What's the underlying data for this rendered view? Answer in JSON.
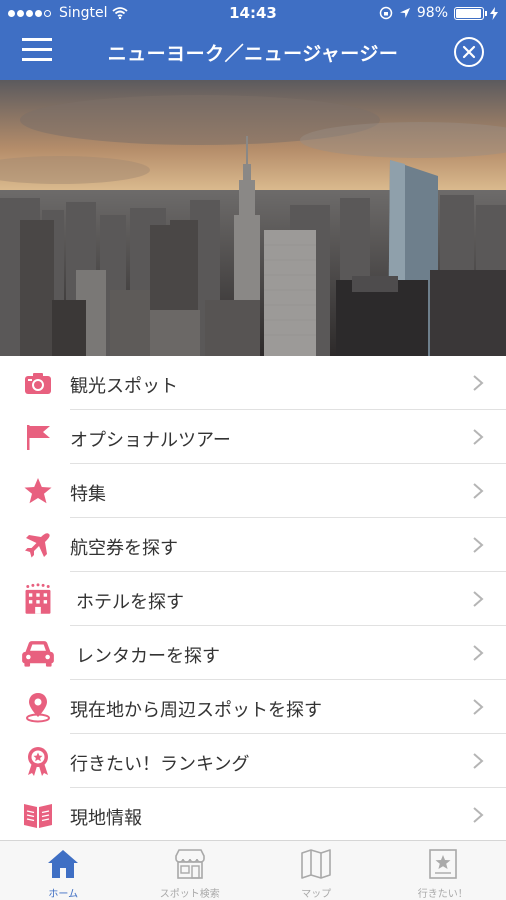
{
  "status_bar": {
    "carrier": "Singtel",
    "time": "14:43",
    "battery": "98%",
    "battery_level": 0.98
  },
  "header": {
    "title": "ニューヨーク／ニュージャージー",
    "menu_icon": "hamburger-icon",
    "close_icon": "close-circle-icon"
  },
  "colors": {
    "header_bg": "#3f6fc4",
    "accent_pink": "#e8607f",
    "tab_active": "#3f6fc4"
  },
  "menu": {
    "items": [
      {
        "label": "観光スポット",
        "icon": "camera-icon"
      },
      {
        "label": "オプショナルツアー",
        "icon": "flag-icon"
      },
      {
        "label": "特集",
        "icon": "star-icon"
      },
      {
        "label": "航空券を探す",
        "icon": "airplane-icon"
      },
      {
        "label": "ホテルを探す",
        "icon": "hotel-icon"
      },
      {
        "label": "レンタカーを探す",
        "icon": "car-icon"
      },
      {
        "label": "現在地から周辺スポットを探す",
        "icon": "location-pin-icon"
      },
      {
        "label": "行きたい！ランキング",
        "icon": "ranking-badge-icon"
      },
      {
        "label": "現地情報",
        "icon": "book-icon"
      }
    ]
  },
  "tabbar": {
    "tabs": [
      {
        "label": "ホーム",
        "icon": "home-icon",
        "active": true
      },
      {
        "label": "スポット検索",
        "icon": "shop-icon",
        "active": false
      },
      {
        "label": "マップ",
        "icon": "map-icon",
        "active": false
      },
      {
        "label": "行きたい！",
        "icon": "star-list-icon",
        "active": false
      }
    ]
  }
}
